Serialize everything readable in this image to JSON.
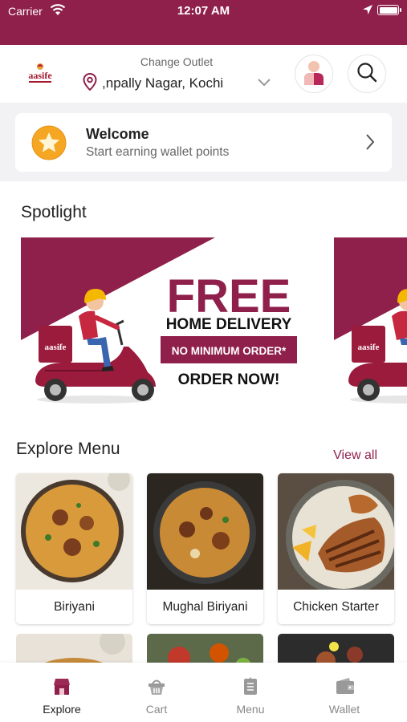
{
  "status_bar": {
    "carrier": "Carrier",
    "time": "12:07 AM"
  },
  "header": {
    "logo_text": "aasife",
    "outlet_label": "Change Outlet",
    "outlet_name": "npally Nagar, Kochi,"
  },
  "welcome": {
    "title": "Welcome",
    "subtitle": "Start earning wallet points"
  },
  "spotlight": {
    "title": "Spotlight",
    "banner": {
      "headline": "FREE",
      "subheadline": "HOME DELIVERY",
      "tag": "NO MINIMUM ORDER*",
      "cta": "ORDER NOW!",
      "box_text": "aasife"
    }
  },
  "explore": {
    "title": "Explore Menu",
    "view_all": "View all",
    "items": [
      {
        "name": "Biriyani"
      },
      {
        "name": "Mughal Biriyani"
      },
      {
        "name": "Chicken Starter"
      }
    ]
  },
  "tabs": [
    {
      "label": "Explore",
      "icon": "store-icon"
    },
    {
      "label": "Cart",
      "icon": "basket-icon"
    },
    {
      "label": "Menu",
      "icon": "menu-book-icon"
    },
    {
      "label": "Wallet",
      "icon": "wallet-icon"
    }
  ],
  "colors": {
    "brand": "#8f1f4b",
    "star": "#f5a623",
    "background": "#f2f2f4"
  }
}
